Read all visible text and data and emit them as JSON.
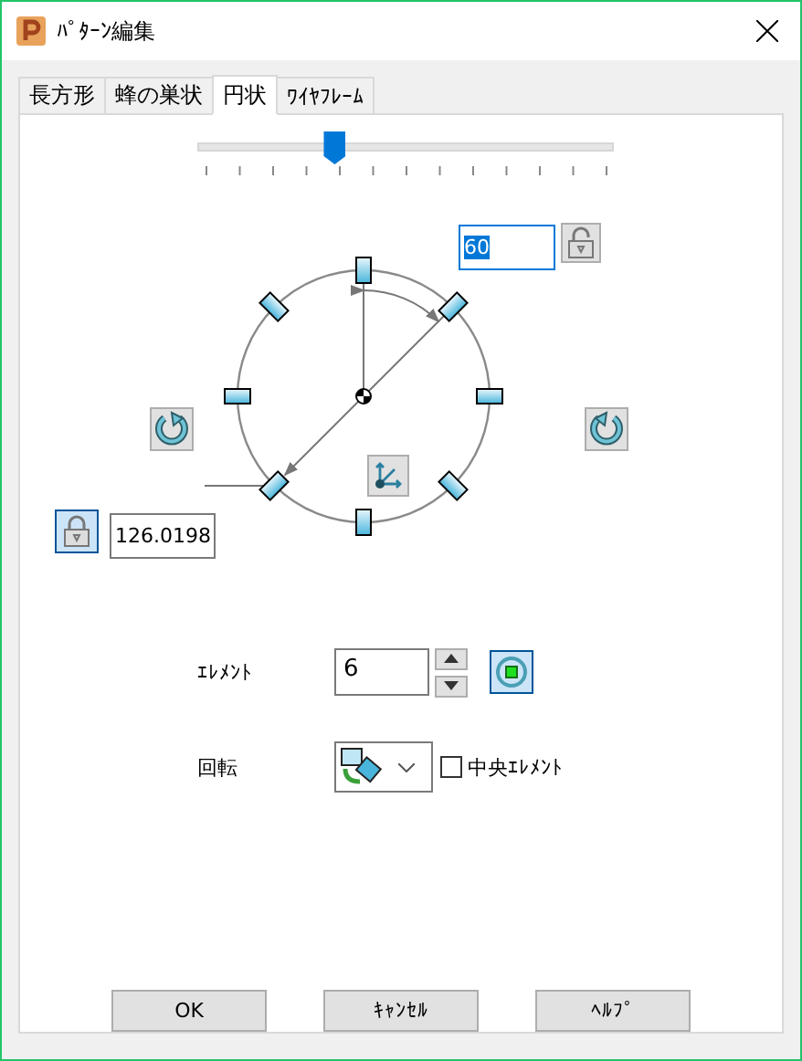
{
  "window": {
    "title": "ﾊﾟﾀｰﾝ編集"
  },
  "tabs": [
    {
      "label": "長方形",
      "selected": false
    },
    {
      "label": "蜂の巣状",
      "selected": false
    },
    {
      "label": "円状",
      "selected": true
    },
    {
      "label": "ﾜｲﾔﾌﾚｰﾑ",
      "selected": false
    }
  ],
  "slider": {
    "level": 0.33
  },
  "angle": {
    "value": "60",
    "locked": false
  },
  "radius": {
    "value": "126.0198",
    "locked": true
  },
  "elements": {
    "label": "ｴﾚﾒﾝﾄ",
    "value": "6",
    "center_pressed": true
  },
  "rotation": {
    "label": "回転",
    "center_element": {
      "label": "中央ｴﾚﾒﾝﾄ",
      "checked": false
    }
  },
  "buttons": [
    "OK",
    "ｷｬﾝｾﾙ",
    "ﾍﾙﾌﾟ"
  ]
}
